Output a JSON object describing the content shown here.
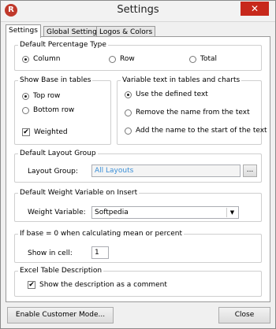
{
  "window": {
    "title": "Settings",
    "close_glyph": "✕",
    "app_icon": "R"
  },
  "tabs": [
    {
      "label": "Settings",
      "active": true
    },
    {
      "label": "Global Settings",
      "active": false
    },
    {
      "label": "Logos & Colors",
      "active": false
    }
  ],
  "default_percentage": {
    "legend": "Default Percentage Type",
    "options": [
      {
        "label": "Column",
        "selected": true
      },
      {
        "label": "Row",
        "selected": false
      },
      {
        "label": "Total",
        "selected": false
      }
    ]
  },
  "show_base": {
    "legend": "Show Base in tables",
    "options": [
      {
        "label": "Top row",
        "selected": true
      },
      {
        "label": "Bottom row",
        "selected": false
      }
    ],
    "weighted": {
      "label": "Weighted",
      "checked": true
    }
  },
  "variable_text": {
    "legend": "Variable text in tables and charts",
    "options": [
      {
        "label": "Use the defined text",
        "selected": true
      },
      {
        "label": "Remove the name from the text",
        "selected": false
      },
      {
        "label": "Add the name to the start of the text",
        "selected": false
      }
    ]
  },
  "layout_group": {
    "legend": "Default Layout Group",
    "label": "Layout Group:",
    "value": "All Layouts",
    "browse_label": "..."
  },
  "weight_variable": {
    "legend": "Default Weight Variable on Insert",
    "label": "Weight Variable:",
    "value": "Softpedia"
  },
  "base_zero": {
    "legend": "If base = 0 when calculating mean or percent",
    "label": "Show in cell:",
    "value": "1"
  },
  "excel": {
    "legend": "Excel Table Description",
    "checkbox": {
      "label": "Show the description as a comment",
      "checked": true
    }
  },
  "footer": {
    "customer_mode_label": "Enable Customer Mode...",
    "close_label": "Close"
  },
  "icons": {
    "check_glyph": "✔",
    "dropdown_glyph": "▼"
  }
}
